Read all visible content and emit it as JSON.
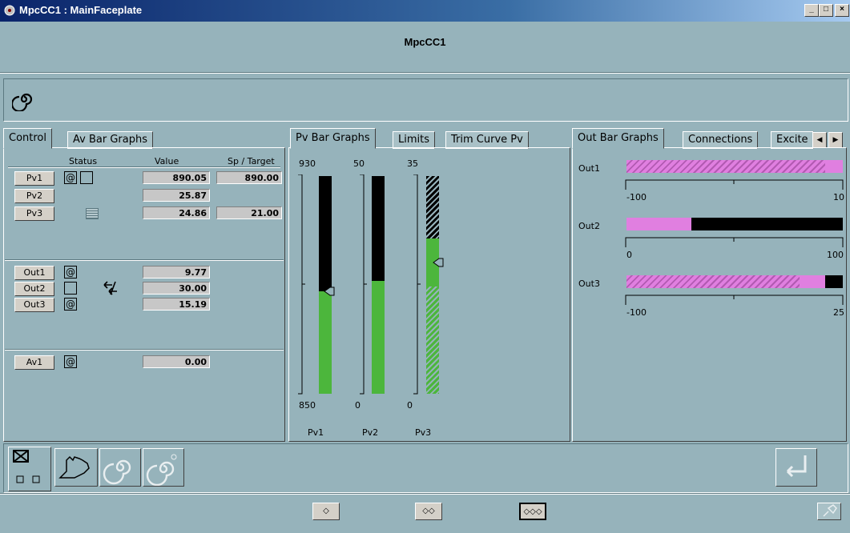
{
  "window": {
    "title": "MpcCC1 : MainFaceplate",
    "minimize": "_",
    "maximize": "□",
    "close": "×"
  },
  "header": {
    "name": "MpcCC1",
    "mode_icon": "spiral-icon"
  },
  "left_panel": {
    "tabs": [
      "Control",
      "Av Bar Graphs"
    ],
    "columns": {
      "status": "Status",
      "value": "Value",
      "sp_target": "Sp / Target"
    },
    "pv_rows": [
      {
        "label": "Pv1",
        "value": "890.05",
        "sp": "890.00"
      },
      {
        "label": "Pv2",
        "value": "25.87",
        "sp": ""
      },
      {
        "label": "Pv3",
        "value": "24.86",
        "sp": "21.00"
      }
    ],
    "out_rows": [
      {
        "label": "Out1",
        "value": "9.77"
      },
      {
        "label": "Out2",
        "value": "30.00"
      },
      {
        "label": "Out3",
        "value": "15.19"
      }
    ],
    "av_rows": [
      {
        "label": "Av1",
        "value": "0.00"
      }
    ]
  },
  "middle_panel": {
    "tabs": [
      "Pv Bar Graphs",
      "Limits",
      "Trim Curve Pv"
    ],
    "bars": [
      {
        "name": "Pv1",
        "max": "930",
        "min": "850",
        "fill_fraction": 0.47,
        "marker_fraction": 0.47
      },
      {
        "name": "Pv2",
        "max": "50",
        "min": "0",
        "fill_fraction": 0.52
      },
      {
        "name": "Pv3",
        "max": "35",
        "min": "0",
        "fill_fraction": 0.71,
        "marker_fraction": 0.6
      }
    ]
  },
  "right_panel": {
    "tabs": [
      "Out Bar Graphs",
      "Connections",
      "Excite"
    ],
    "bars": [
      {
        "name": "Out1",
        "min": "-100",
        "max": "10",
        "fill_fraction": 0.92
      },
      {
        "name": "Out2",
        "min": "0",
        "max": "100",
        "fill_fraction": 0.3
      },
      {
        "name": "Out3",
        "min": "-100",
        "max": "25",
        "fill_fraction": 0.92
      }
    ]
  },
  "colors": {
    "background": "#96b3bb",
    "green": "#4cb63c",
    "pink": "#e07fe0",
    "title_blue": "#0a246a"
  }
}
